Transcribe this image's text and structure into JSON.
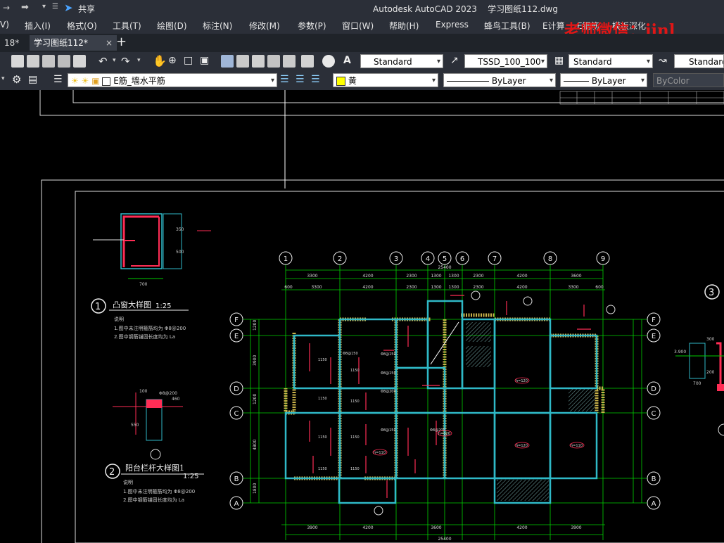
{
  "window": {
    "title": "Autodesk AutoCAD 2023    学习图纸112.dwg",
    "share_label": "共享",
    "watermark": "老师微信：jinl"
  },
  "menu": {
    "items": [
      "V)",
      "插入(I)",
      "格式(O)",
      "工具(T)",
      "绘图(D)",
      "标注(N)",
      "修改(M)",
      "参数(P)",
      "窗口(W)",
      "帮助(H)",
      "Express",
      "蜂鸟工具(B)",
      "E计算",
      "E钢筋",
      "模板深化"
    ]
  },
  "tabs": {
    "items": [
      "18*",
      "学习图纸112*"
    ],
    "close_glyph": "×",
    "add_glyph": "+"
  },
  "toolbar1": {
    "text_style": "Standard",
    "dim_style": "TSSD_100_100",
    "table_style": "Standard",
    "multileader_style": "Standard"
  },
  "toolbar2": {
    "layer": "E筋_墙水平筋",
    "color": "黄",
    "linetype": "ByLayer",
    "lineweight": "ByLayer",
    "plotstyle": "ByColor"
  },
  "colors": {
    "ui_bg": "#2b2f38",
    "canvas_bg": "#000000",
    "grid": "#00d200",
    "wall": "#2fb9c7",
    "hatch": "#c9b24a",
    "rebar": "#ff2d55",
    "watermark": "#e01616"
  },
  "drawing": {
    "axis_top": [
      "1",
      "2",
      "3",
      "4",
      "5",
      "6",
      "7",
      "8",
      "9"
    ],
    "axis_side": [
      "F",
      "E",
      "D",
      "C",
      "B",
      "A"
    ],
    "dims_top_total": "25400",
    "dims_top": [
      "3300",
      "4200",
      "2300",
      "1300",
      "1300",
      "2300",
      "4200",
      "3600"
    ],
    "dims_top2": [
      "600",
      "3300",
      "4200",
      "2300",
      "1300",
      "1300",
      "2300",
      "4200",
      "3300",
      "600"
    ],
    "dims_bottom": [
      "3900",
      "4200",
      "3600",
      "4200",
      "3900"
    ],
    "dims_bottom_total": "25400",
    "dims_left": [
      "1200",
      "3900",
      "1200",
      "4800",
      "1800"
    ],
    "detail1": {
      "num": "1",
      "title": "凸窗大样图",
      "scale": "1:25",
      "note_head": "说明",
      "note1": "1.图中未注明箍筋均为 Φ8@200",
      "note2": "2.图中钢筋锚固长度均为 La"
    },
    "detail2": {
      "num": "2",
      "title": "阳台栏杆大样图1",
      "scale": "1:25",
      "note_head": "说明",
      "note1": "1.图中未注明箍筋均为 Φ8@200",
      "note2": "2.图中钢筋锚固长度均为 La"
    },
    "detail3": {
      "num": "3"
    },
    "detail1_dims": [
      "700",
      "350",
      "500"
    ],
    "detail2_dims": [
      "Φ8@200",
      "460",
      "100",
      "550"
    ],
    "detail3_dims": [
      "3.900",
      "700",
      "300",
      "200"
    ],
    "room_labels": [
      "h=120",
      "h=120",
      "h=110",
      "h=120",
      "h=110"
    ],
    "span_labels": [
      "1150",
      "1150",
      "1150",
      "1150",
      "1150",
      "1150",
      "1150",
      "1150"
    ],
    "rebar_labels": [
      "Φ8@150",
      "Φ8@150",
      "Φ8@150",
      "Φ8@200",
      "Φ8@150",
      "Φ8@200"
    ]
  }
}
